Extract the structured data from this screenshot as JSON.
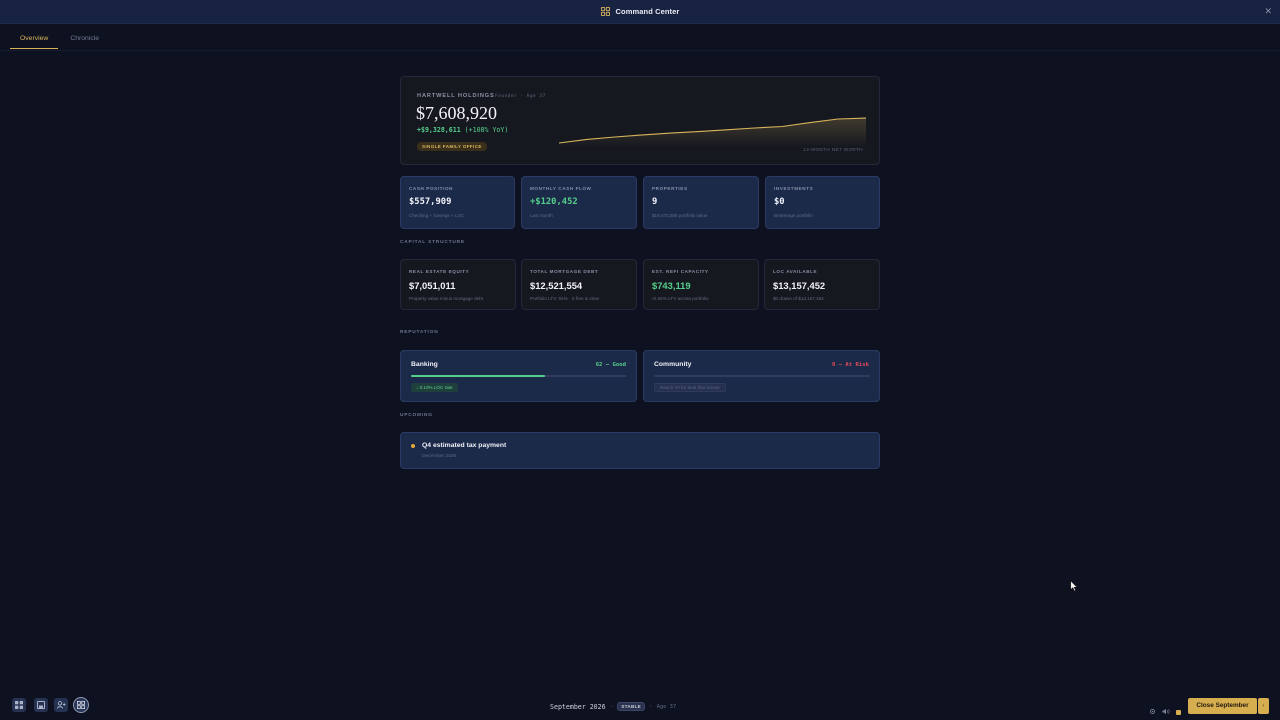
{
  "window": {
    "title": "Command Center",
    "title_icon": "grid-icon",
    "close_icon": "close-icon"
  },
  "tabs": [
    {
      "label": "Overview",
      "active": true
    },
    {
      "label": "Chronicle",
      "active": false
    }
  ],
  "hero": {
    "company": "HARTWELL HOLDINGS",
    "role_age": "Founder  ·  Age 37",
    "net_worth": "$7,608,920",
    "change": "+$9,328,611",
    "change_pct": "(+108% YoY)",
    "badge": "SINGLE FAMILY OFFICE",
    "chart_label": "12-MONTH NET WORTH",
    "sparkline_trend": [
      0.0,
      0.12,
      0.2,
      0.27,
      0.33,
      0.38,
      0.44,
      0.5,
      0.55,
      0.68,
      0.8,
      0.83
    ]
  },
  "stats": [
    {
      "label": "CASH POSITION",
      "value": "$557,909",
      "sub": "Checking + Savings + LOC"
    },
    {
      "label": "MONTHLY CASH FLOW",
      "value": "+$120,452",
      "sub": "Last month"
    },
    {
      "label": "PROPERTIES",
      "value": "9",
      "sub": "$19,572,585 portfolio value"
    },
    {
      "label": "INVESTMENTS",
      "value": "$0",
      "sub": "Brokerage portfolio"
    }
  ],
  "capital_structure": {
    "heading": "CAPITAL STRUCTURE",
    "cards": [
      {
        "label": "REAL ESTATE EQUITY",
        "value": "$7,051,011",
        "sub": "Property value minus mortgage debt"
      },
      {
        "label": "TOTAL MORTGAGE DEBT",
        "value": "$12,521,554",
        "sub": "Portfolio LTV: 64% · 0 free & clear"
      },
      {
        "label": "EST. REFI CAPACITY",
        "value": "$743,119",
        "sub": "At 65% LTV across portfolio"
      },
      {
        "label": "LOC AVAILABLE",
        "value": "$13,157,452",
        "sub": "$0 drawn of $13,157,452"
      }
    ]
  },
  "reputation": {
    "heading": "REPUTATION",
    "banking": {
      "name": "Banking",
      "score": "62 — Good",
      "level": 0.62,
      "chip": "↓ 0.10% LOC rate"
    },
    "community": {
      "name": "Community",
      "score": "0 — At Risk",
      "level": 0.0,
      "chip": "Reach 70 for deal flow bonus"
    }
  },
  "upcoming": {
    "heading": "UPCOMING",
    "items": [
      {
        "title": "Q4 estimated tax payment",
        "date": "December 2026"
      }
    ]
  },
  "bottom": {
    "month": "September 2026",
    "status": "STABLE",
    "age": "Age 37",
    "close_button": "Close September",
    "icons": [
      "dashboard-icon",
      "save-icon",
      "people-icon",
      "grid-icon"
    ]
  },
  "colors": {
    "accent": "#d7ae4f",
    "positive": "#55d08a",
    "negative": "#e04a5a",
    "card": "#1c2a4a"
  }
}
